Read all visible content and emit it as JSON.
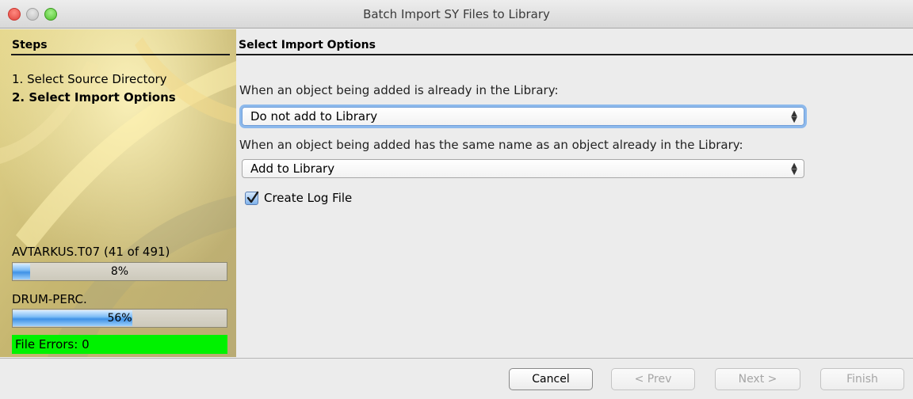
{
  "window": {
    "title": "Batch Import SY Files to Library"
  },
  "sidebar": {
    "heading": "Steps",
    "steps": [
      {
        "label": "1. Select Source Directory",
        "active": false
      },
      {
        "label": "2. Select Import Options",
        "active": true
      }
    ],
    "progress": [
      {
        "label": "AVTARKUS.T07 (41 of 491)",
        "percent": 8,
        "percent_text": "8%"
      },
      {
        "label": "DRUM-PERC.",
        "percent": 56,
        "percent_text": "56%"
      }
    ],
    "errors_text": "File Errors: 0",
    "errors_color": "#00f200"
  },
  "main": {
    "heading": "Select Import Options",
    "q1": "When an object being added is already in the Library:",
    "select1": {
      "value": "Do not add to Library"
    },
    "q2": "When an object being added has the same name as an object already in the Library:",
    "select2": {
      "value": "Add to Library"
    },
    "log_checkbox": {
      "label": "Create Log File",
      "checked": true
    }
  },
  "buttons": {
    "cancel": "Cancel",
    "prev": "< Prev",
    "next": "Next >",
    "finish": "Finish"
  }
}
